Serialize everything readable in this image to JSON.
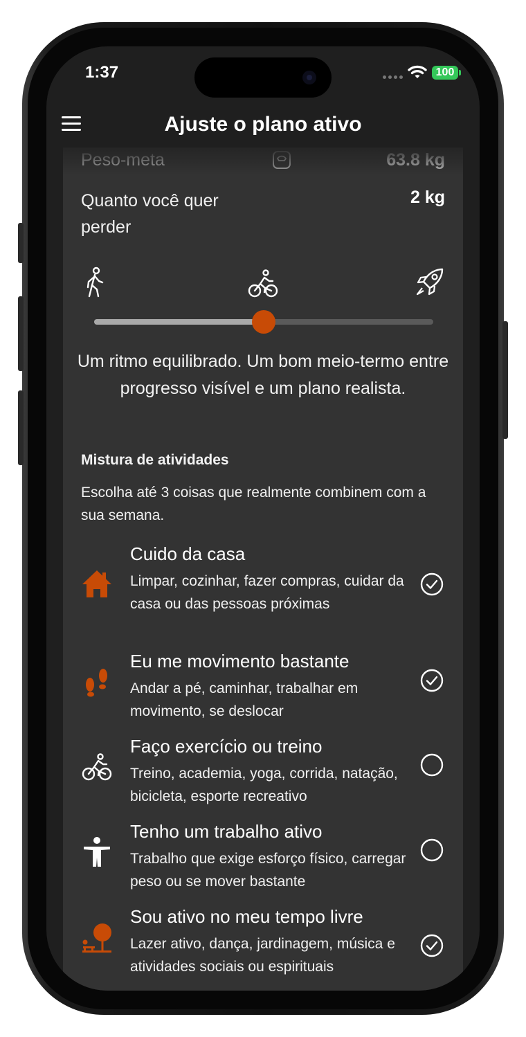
{
  "status_bar": {
    "time": "1:37",
    "battery": "100"
  },
  "header": {
    "title": "Ajuste o plano ativo"
  },
  "goal": {
    "label": "Peso-meta",
    "value": "63.8 kg"
  },
  "lose": {
    "label": "Quanto você quer perder",
    "value": "2 kg"
  },
  "pace": {
    "icons": [
      "walking-icon",
      "bicycle-icon",
      "rocket-icon"
    ],
    "level": 0.5,
    "description": "Um ritmo equilibrado. Um bom meio-termo entre progresso visível e um plano realista."
  },
  "activities": {
    "title": "Mistura de atividades",
    "subtitle": "Escolha até 3 coisas que realmente combinem com a sua semana.",
    "items": [
      {
        "title": "Cuido da casa",
        "description": "Limpar, cozinhar, fazer compras, cuidar da casa ou das pessoas próximas",
        "icon": "house-icon",
        "selected": true
      },
      {
        "title": "Eu me movimento bastante",
        "description": "Andar a pé, caminhar, trabalhar em movimento, se deslocar",
        "icon": "footprints-icon",
        "selected": true
      },
      {
        "title": "Faço exercício ou treino",
        "description": "Treino, academia, yoga, corrida, natação, bicicleta, esporte recreativo",
        "icon": "bicycle-icon",
        "selected": false
      },
      {
        "title": "Tenho um trabalho ativo",
        "description": "Trabalho que exige esforço físico, carregar peso ou se mover bastante",
        "icon": "person-icon",
        "selected": false
      },
      {
        "title": "Sou ativo no meu tempo livre",
        "description": "Lazer ativo, dança, jardinagem, música e atividades sociais ou espirituais",
        "icon": "leisure-icon",
        "selected": true
      }
    ]
  },
  "colors": {
    "accent": "#c84b06",
    "background": "#1f1f1f",
    "card": "#333333",
    "battery": "#34c759"
  }
}
